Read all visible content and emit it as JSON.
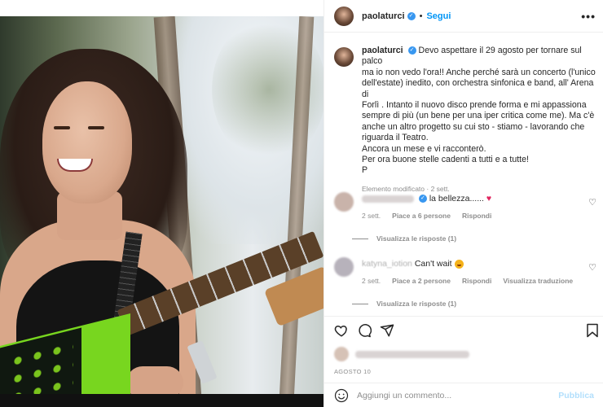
{
  "post": {
    "username": "paolaturci",
    "follow_label": "Segui",
    "more_label": "•••",
    "image_alt": "Paola Turci singing with guitar"
  },
  "caption": {
    "username": "paolaturci",
    "lines": [
      "Devo aspettare il 29 agosto per tornare sul palco",
      "ma io non vedo l'ora!! Anche perché sarà un concerto (l'unico",
      "dell'estate) inedito, con orchestra sinfonica e band, all' Arena di",
      "Forlì . Intanto il nuovo disco prende forma e mi appassiona",
      "sempre di più (un bene per una iper critica come me). Ma c'è",
      "anche un altro progetto su cui sto - stiamo - lavorando che",
      "riguarda il Teatro.",
      "Ancora un mese e vi racconterò.",
      "Per ora buone stelle cadenti a tutti e a tutte!",
      "P"
    ],
    "meta": "Elemento modificato · 2 sett."
  },
  "comments": [
    {
      "text": "la bellezza......",
      "time": "2 sett.",
      "likes": "Piace a 6 persone",
      "reply": "Rispondi",
      "translate": "",
      "replies": "Visualizza le risposte (1)"
    },
    {
      "handle": "katyna_iotion",
      "text": "Can't wait",
      "time": "2 sett.",
      "likes": "Piace a 2 persone",
      "reply": "Rispondi",
      "translate": "Visualizza traduzione",
      "replies": "Visualizza le risposte (1)"
    }
  ],
  "footer": {
    "date": "AGOSTO 10",
    "comment_placeholder": "Aggiungi un commento...",
    "publish_label": "Pubblica"
  },
  "colors": {
    "accent": "#0095f6",
    "verified": "#3897f0",
    "muted": "#8e8e8e",
    "heart": "#e0245e"
  }
}
